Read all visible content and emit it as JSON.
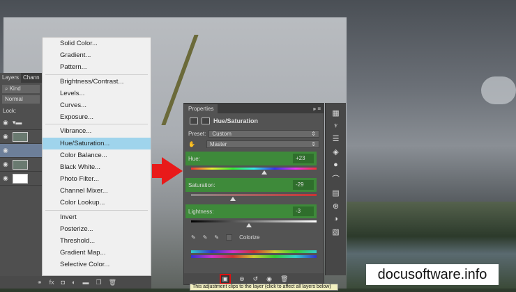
{
  "layers_panel": {
    "tabs": [
      "Layers",
      "Chann"
    ],
    "kind": "Kind",
    "blend": "Normal",
    "lock_label": "Lock:"
  },
  "menu": {
    "groups": [
      [
        "Solid Color...",
        "Gradient...",
        "Pattern..."
      ],
      [
        "Brightness/Contrast...",
        "Levels...",
        "Curves...",
        "Exposure..."
      ],
      [
        "Vibrance...",
        "Hue/Saturation...",
        "Color Balance...",
        "Black  White...",
        "Photo Filter...",
        "Channel Mixer...",
        "Color Lookup..."
      ],
      [
        "Invert",
        "Posterize...",
        "Threshold...",
        "Gradient Map...",
        "Selective Color..."
      ]
    ],
    "selected": "Hue/Saturation..."
  },
  "properties": {
    "tab": "Properties",
    "title": "Hue/Saturation",
    "preset_label": "Preset:",
    "preset": "Custom",
    "channel": "Master",
    "hue_label": "Hue:",
    "hue": "+23",
    "saturation_label": "Saturation:",
    "saturation": "-29",
    "lightness_label": "Lightness:",
    "lightness": "-3",
    "colorize": "Colorize"
  },
  "tooltip": "This adjustment clips to the layer (click to affect all layers below)",
  "watermark": "docusoftware.info",
  "colors": {
    "highlight": "#3e8a3a",
    "arrow": "#e81a1a",
    "menu_selected": "#9fd4ec"
  }
}
